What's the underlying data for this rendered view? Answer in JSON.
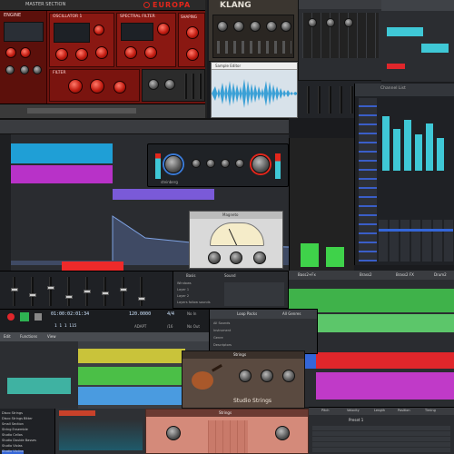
{
  "europa": {
    "title": "EUROPA",
    "master_section": "MASTER SECTION",
    "module_labels": [
      "ENGINE",
      "OSCILLATOR 1",
      "FILTER",
      "SPECTRAL FILTER",
      "HARMONICS",
      "VOICES",
      "SHAPING"
    ],
    "filter_label": "FILTER",
    "colors": {
      "panel": "#8a1812",
      "accent": "#e3261b",
      "knob": "#c41d12"
    }
  },
  "klang": {
    "title": "KLANG",
    "colors": {
      "panel": "#3b3630"
    }
  },
  "audio_editor": {
    "tabs": [
      "Sample Editor"
    ],
    "colors": {
      "wave": "#3aa0d6",
      "bg": "#d8e2ea"
    }
  },
  "mixer_top": {
    "title": "Channel List",
    "strip_names": [
      "1",
      "2",
      "3",
      "4",
      "5",
      "6",
      "7",
      "8"
    ],
    "colors": {
      "meter": "#3fc8d6"
    }
  },
  "arranger_left": {
    "colors": {
      "track1": "#1f9fd6",
      "track2": "#b832c8",
      "track3": "#7a5ad8",
      "track4": "#ee2a2a"
    }
  },
  "compressor": {
    "brand": "steinberg",
    "labels": [
      "THRESHOLD",
      "RATIO",
      "ATTACK",
      "RELEASE",
      "MAKEUP",
      "MIX"
    ]
  },
  "eq_plugin": {
    "title": "Magneto",
    "colors": {
      "bg": "#d9d9d9"
    }
  },
  "transport": {
    "time": "01:00:02:01:34",
    "bars": "1 1 1 115",
    "tempo": "120.0000",
    "signature": "4/4",
    "signature_sub": "/16",
    "adapt": "ADAPT",
    "no_in": "No In",
    "no_out": "No Out",
    "edit_menu": "Edit",
    "functions_menu": "Functions",
    "view_menu": "View"
  },
  "library": {
    "header_items": [
      "Loop Packs",
      "All Genres"
    ],
    "sections": [
      "All Sounds",
      "Instrument",
      "Genre",
      "Descriptors"
    ]
  },
  "strings_plugin": {
    "header": "Strings",
    "title": "Studio Strings",
    "colors": {
      "bg": "#5a4a40"
    }
  },
  "browser_list": {
    "items": [
      "Disco Strings",
      "Disco Strings Bitter",
      "Small Section",
      "String Ensemble",
      "Studio Cellos",
      "Studio Double Basses",
      "Studio Violas",
      "Studio Violins"
    ]
  },
  "mid_toolbar": {
    "labels": [
      "Basis",
      "Sound",
      "Basis"
    ],
    "menu": [
      "Windows",
      "Tools",
      "Layer 1",
      "Layer 2",
      "Layers follow sounds",
      "Follow Mode",
      "Follow Scroll"
    ]
  },
  "arranger_right": {
    "tracks": [
      "Bass2+Fx",
      "Brass2",
      "Brass2 FX",
      "Drum2"
    ],
    "colors": {
      "green": "#3fb24a",
      "red": "#e0262b",
      "purple": "#c03ac8",
      "blue": "#3466d8"
    }
  },
  "bottom_right_editor": {
    "columns": [
      "Pitch",
      "Velocity",
      "Length",
      "Position",
      "Timing",
      "Gate"
    ],
    "value": "Preset 1"
  },
  "bottom_pink_plugin": {
    "header": "Strings",
    "colors": {
      "bg": "#d48a7a"
    }
  }
}
